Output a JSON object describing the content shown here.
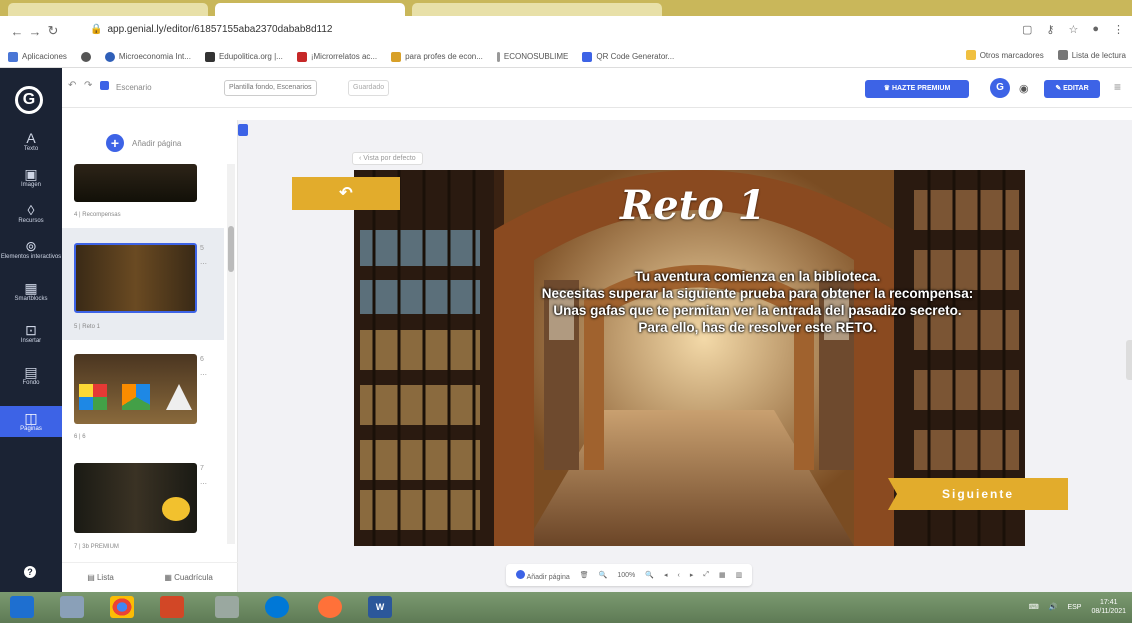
{
  "browser": {
    "url": "app.genial.ly/editor/61857155aba2370dabab8d112",
    "bookmarks": [
      {
        "label": "Aplicaciones",
        "color": "#4a76d6"
      },
      {
        "label": "",
        "color": "#555"
      },
      {
        "label": "Microeconomia Int...",
        "color": "#2f5fb8"
      },
      {
        "label": "Edupolitica.org |...",
        "color": "#333"
      },
      {
        "label": "¡Microrrelatos ac...",
        "color": "#c62828"
      },
      {
        "label": "para profes de econ...",
        "color": "#d8a028"
      },
      {
        "label": "ECONOSUBLIME",
        "color": "#777"
      },
      {
        "label": "QR Code Generator...",
        "color": "#3d63e6"
      }
    ],
    "bookmarks_right": [
      "Otros marcadores",
      "Lista de lectura"
    ]
  },
  "app": {
    "undo_icon": "undo-icon",
    "doc_name": "Escenario",
    "template_pill": "Plantilla fondo, Escenarios",
    "status": "Guardado",
    "premium_label": "HAZTE PREMIUM",
    "avatar_letter": "G",
    "share_label": "EDITAR"
  },
  "rail": {
    "logo": "G",
    "items": [
      {
        "glyph": "A",
        "label": "Texto"
      },
      {
        "glyph": "▣",
        "label": "Imagen"
      },
      {
        "glyph": "◊",
        "label": "Recursos"
      },
      {
        "glyph": "⊚",
        "label": "Elementos interactivos"
      },
      {
        "glyph": "▦",
        "label": "Smartblocks"
      },
      {
        "glyph": "⊡",
        "label": "Insertar"
      },
      {
        "glyph": "▤",
        "label": "Fondo"
      },
      {
        "glyph": "◫",
        "label": "Páginas"
      }
    ],
    "help": "?"
  },
  "panel": {
    "add_page": "Añadir página",
    "pages": [
      {
        "label": "4 | Recompensas",
        "num": ""
      },
      {
        "label": "5 | Reto 1",
        "num": "5"
      },
      {
        "label": "6 | 6",
        "num": "6"
      },
      {
        "label": "7 | 3b PREMIUM",
        "num": "7"
      }
    ],
    "view_list": "Lista",
    "view_grid": "Cuadrícula"
  },
  "slide": {
    "go_back": "Vista por defecto",
    "back_arrow": "↶",
    "title": "Reto 1",
    "lines": [
      "Tu aventura comienza en la biblioteca.",
      "Necesitas superar  la siguiente prueba para obtener la recompensa:",
      "Unas gafas  que te permitan  ver la entrada del pasadizo secreto.",
      "Para ello,  has de resolver este RETO."
    ],
    "next_label": "Siguiente"
  },
  "bottom": {
    "add_page": "Añadir página",
    "zoom": "100%"
  },
  "taskbar": {
    "lang": "ESP",
    "time": "17:41",
    "date": "08/11/2021"
  },
  "colors": {
    "accent": "#3d63e6",
    "gold": "#e2ac2c",
    "rail": "#1b2334"
  }
}
